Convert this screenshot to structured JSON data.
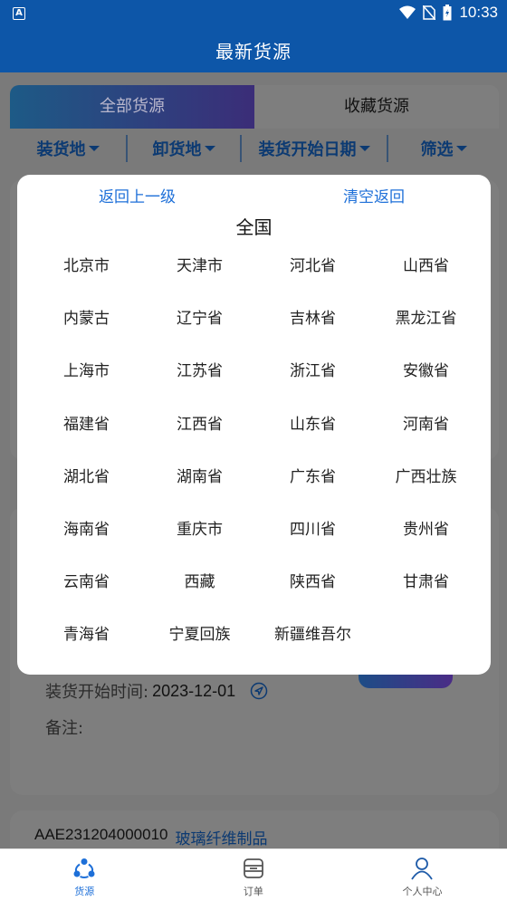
{
  "status_bar": {
    "time": "10:33",
    "a_badge": "A"
  },
  "app_bar": {
    "title": "最新货源"
  },
  "tabs": {
    "all": "全部货源",
    "favorites": "收藏货源"
  },
  "filters": {
    "load_place": "装货地",
    "unload_place": "卸货地",
    "load_start_date": "装货开始日期",
    "screen": "筛选"
  },
  "card": {
    "load_start_label": "装货开始时间:",
    "load_start_value": "2023-12-01",
    "remark_label": "备注:"
  },
  "next_card": {
    "id": "AAE231204000010",
    "category": "玻璃纤维制品"
  },
  "region_picker": {
    "back_label": "返回上一级",
    "clear_label": "清空返回",
    "title": "全国",
    "provinces": [
      "北京市",
      "天津市",
      "河北省",
      "山西省",
      "内蒙古",
      "辽宁省",
      "吉林省",
      "黑龙江省",
      "上海市",
      "江苏省",
      "浙江省",
      "安徽省",
      "福建省",
      "江西省",
      "山东省",
      "河南省",
      "湖北省",
      "湖南省",
      "广东省",
      "广西壮族",
      "海南省",
      "重庆市",
      "四川省",
      "贵州省",
      "云南省",
      "西藏",
      "陕西省",
      "甘肃省",
      "青海省",
      "宁夏回族",
      "新疆维吾尔"
    ]
  },
  "bottom_nav": {
    "source": "货源",
    "orders": "订单",
    "profile": "个人中心"
  },
  "colors": {
    "primary": "#0d56a8",
    "link": "#1d6fd8",
    "overlay": "#7a7a7a"
  }
}
